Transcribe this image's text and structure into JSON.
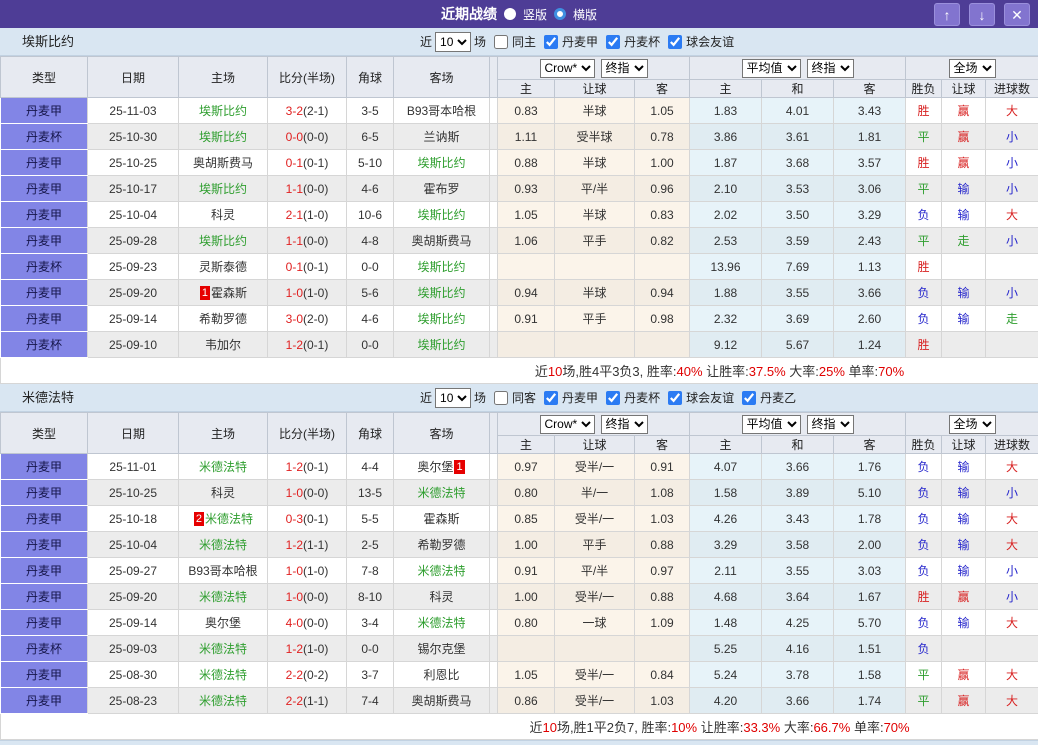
{
  "titlebar": {
    "title": "近期战绩",
    "options": [
      {
        "label": "竖版",
        "selected": true
      },
      {
        "label": "横版",
        "selected": false
      }
    ],
    "buttons": {
      "up": "↑",
      "down": "↓",
      "close": "✕"
    }
  },
  "table_header": {
    "left_cols": [
      "类型",
      "日期",
      "主场",
      "比分(半场)",
      "角球",
      "客场"
    ],
    "let_cols": [
      "主",
      "让球",
      "客"
    ],
    "avg_cols": [
      "主",
      "和",
      "客"
    ],
    "result_cols": [
      "胜负",
      "让球",
      "进球数"
    ],
    "dropdowns": {
      "bookmaker": "Crow*",
      "bookmaker_time": "终指",
      "average": "平均值",
      "average_time": "终指",
      "scope": "全场"
    }
  },
  "colors": {
    "accent_purple": "#4e3d96",
    "type_cell": "#8285e6",
    "self_team_green": "#2e9e2e",
    "win_red": "#d82222",
    "lose_blue": "#2626cc",
    "draw_green": "#2e9e2e",
    "result_map": {
      "胜": "red",
      "平": "green",
      "负": "blue",
      "赢": "red",
      "输": "blue",
      "走": "green",
      "大": "red",
      "小": "blue"
    }
  },
  "sections": [
    {
      "team": "埃斯比约",
      "filter": {
        "near_label": "近",
        "count": "10",
        "games_label": "场",
        "same": {
          "label": "同主",
          "checked": false
        },
        "leagues": [
          {
            "label": "丹麦甲",
            "checked": true
          },
          {
            "label": "丹麦杯",
            "checked": true
          },
          {
            "label": "球会友谊",
            "checked": true
          }
        ]
      },
      "rows": [
        {
          "type": "丹麦甲",
          "date": "25-11-03",
          "home": "埃斯比约",
          "home_self": true,
          "score": "3-2",
          "half": "(2-1)",
          "corner": "3-5",
          "away": "B93哥本哈根",
          "let": [
            "0.83",
            "半球",
            "1.05"
          ],
          "avg": [
            "1.83",
            "4.01",
            "3.43"
          ],
          "res": [
            "胜",
            "赢",
            "大"
          ]
        },
        {
          "type": "丹麦杯",
          "date": "25-10-30",
          "home": "埃斯比约",
          "home_self": true,
          "score": "0-0",
          "half": "(0-0)",
          "corner": "6-5",
          "away": "兰讷斯",
          "let": [
            "1.11",
            "受半球",
            "0.78"
          ],
          "avg": [
            "3.86",
            "3.61",
            "1.81"
          ],
          "res": [
            "平",
            "赢",
            "小"
          ]
        },
        {
          "type": "丹麦甲",
          "date": "25-10-25",
          "home": "奥胡斯费马",
          "score": "0-1",
          "half": "(0-1)",
          "corner": "5-10",
          "away": "埃斯比约",
          "away_self": true,
          "let": [
            "0.88",
            "半球",
            "1.00"
          ],
          "avg": [
            "1.87",
            "3.68",
            "3.57"
          ],
          "res": [
            "胜",
            "赢",
            "小"
          ]
        },
        {
          "type": "丹麦甲",
          "date": "25-10-17",
          "home": "埃斯比约",
          "home_self": true,
          "score": "1-1",
          "half": "(0-0)",
          "corner": "4-6",
          "away": "霍布罗",
          "let": [
            "0.93",
            "平/半",
            "0.96"
          ],
          "avg": [
            "2.10",
            "3.53",
            "3.06"
          ],
          "res": [
            "平",
            "输",
            "小"
          ]
        },
        {
          "type": "丹麦甲",
          "date": "25-10-04",
          "home": "科灵",
          "score": "2-1",
          "half": "(1-0)",
          "corner": "10-6",
          "away": "埃斯比约",
          "away_self": true,
          "let": [
            "1.05",
            "半球",
            "0.83"
          ],
          "avg": [
            "2.02",
            "3.50",
            "3.29"
          ],
          "res": [
            "负",
            "输",
            "大"
          ]
        },
        {
          "type": "丹麦甲",
          "date": "25-09-28",
          "home": "埃斯比约",
          "home_self": true,
          "score": "1-1",
          "half": "(0-0)",
          "corner": "4-8",
          "away": "奥胡斯费马",
          "let": [
            "1.06",
            "平手",
            "0.82"
          ],
          "avg": [
            "2.53",
            "3.59",
            "2.43"
          ],
          "res": [
            "平",
            "走",
            "小"
          ]
        },
        {
          "type": "丹麦杯",
          "date": "25-09-23",
          "home": "灵斯泰德",
          "score": "0-1",
          "half": "(0-1)",
          "corner": "0-0",
          "away": "埃斯比约",
          "away_self": true,
          "let": [
            "",
            "",
            ""
          ],
          "avg": [
            "13.96",
            "7.69",
            "1.13"
          ],
          "res": [
            "胜",
            "",
            ""
          ]
        },
        {
          "type": "丹麦甲",
          "date": "25-09-20",
          "home": "霍森斯",
          "home_badge": "1",
          "score": "1-0",
          "half": "(1-0)",
          "corner": "5-6",
          "away": "埃斯比约",
          "away_self": true,
          "let": [
            "0.94",
            "半球",
            "0.94"
          ],
          "avg": [
            "1.88",
            "3.55",
            "3.66"
          ],
          "res": [
            "负",
            "输",
            "小"
          ]
        },
        {
          "type": "丹麦甲",
          "date": "25-09-14",
          "home": "希勒罗德",
          "score": "3-0",
          "half": "(2-0)",
          "corner": "4-6",
          "away": "埃斯比约",
          "away_self": true,
          "let": [
            "0.91",
            "平手",
            "0.98"
          ],
          "avg": [
            "2.32",
            "3.69",
            "2.60"
          ],
          "res": [
            "负",
            "输",
            "走"
          ]
        },
        {
          "type": "丹麦杯",
          "date": "25-09-10",
          "home": "韦加尔",
          "score": "1-2",
          "half": "(0-1)",
          "corner": "0-0",
          "away": "埃斯比约",
          "away_self": true,
          "let": [
            "",
            "",
            ""
          ],
          "avg": [
            "9.12",
            "5.67",
            "1.24"
          ],
          "res": [
            "胜",
            "",
            ""
          ]
        }
      ],
      "summary": [
        {
          "text": "近",
          "red": false
        },
        {
          "text": "10",
          "red": true
        },
        {
          "text": "场,胜4平3负3, 胜率:",
          "red": false
        },
        {
          "text": "40%",
          "red": true
        },
        {
          "text": " 让胜率:",
          "red": false
        },
        {
          "text": "37.5%",
          "red": true
        },
        {
          "text": " 大率:",
          "red": false
        },
        {
          "text": "25%",
          "red": true
        },
        {
          "text": " 单率:",
          "red": false
        },
        {
          "text": "70%",
          "red": true
        }
      ]
    },
    {
      "team": "米德法特",
      "filter": {
        "near_label": "近",
        "count": "10",
        "games_label": "场",
        "same": {
          "label": "同客",
          "checked": false
        },
        "leagues": [
          {
            "label": "丹麦甲",
            "checked": true
          },
          {
            "label": "丹麦杯",
            "checked": true
          },
          {
            "label": "球会友谊",
            "checked": true
          },
          {
            "label": "丹麦乙",
            "checked": true
          }
        ]
      },
      "rows": [
        {
          "type": "丹麦甲",
          "date": "25-11-01",
          "home": "米德法特",
          "home_self": true,
          "score": "1-2",
          "half": "(0-1)",
          "corner": "4-4",
          "away": "奥尔堡",
          "away_badge_post": "1",
          "let": [
            "0.97",
            "受半/一",
            "0.91"
          ],
          "avg": [
            "4.07",
            "3.66",
            "1.76"
          ],
          "res": [
            "负",
            "输",
            "大"
          ]
        },
        {
          "type": "丹麦甲",
          "date": "25-10-25",
          "home": "科灵",
          "score": "1-0",
          "half": "(0-0)",
          "corner": "13-5",
          "away": "米德法特",
          "away_self": true,
          "let": [
            "0.80",
            "半/一",
            "1.08"
          ],
          "avg": [
            "1.58",
            "3.89",
            "5.10"
          ],
          "res": [
            "负",
            "输",
            "小"
          ]
        },
        {
          "type": "丹麦甲",
          "date": "25-10-18",
          "home": "米德法特",
          "home_self": true,
          "home_badge": "2",
          "score": "0-3",
          "half": "(0-1)",
          "corner": "5-5",
          "away": "霍森斯",
          "let": [
            "0.85",
            "受半/一",
            "1.03"
          ],
          "avg": [
            "4.26",
            "3.43",
            "1.78"
          ],
          "res": [
            "负",
            "输",
            "大"
          ]
        },
        {
          "type": "丹麦甲",
          "date": "25-10-04",
          "home": "米德法特",
          "home_self": true,
          "score": "1-2",
          "half": "(1-1)",
          "corner": "2-5",
          "away": "希勒罗德",
          "let": [
            "1.00",
            "平手",
            "0.88"
          ],
          "avg": [
            "3.29",
            "3.58",
            "2.00"
          ],
          "res": [
            "负",
            "输",
            "大"
          ]
        },
        {
          "type": "丹麦甲",
          "date": "25-09-27",
          "home": "B93哥本哈根",
          "score": "1-0",
          "half": "(1-0)",
          "corner": "7-8",
          "away": "米德法特",
          "away_self": true,
          "let": [
            "0.91",
            "平/半",
            "0.97"
          ],
          "avg": [
            "2.11",
            "3.55",
            "3.03"
          ],
          "res": [
            "负",
            "输",
            "小"
          ]
        },
        {
          "type": "丹麦甲",
          "date": "25-09-20",
          "home": "米德法特",
          "home_self": true,
          "score": "1-0",
          "half": "(0-0)",
          "corner": "8-10",
          "away": "科灵",
          "let": [
            "1.00",
            "受半/一",
            "0.88"
          ],
          "avg": [
            "4.68",
            "3.64",
            "1.67"
          ],
          "res": [
            "胜",
            "赢",
            "小"
          ]
        },
        {
          "type": "丹麦甲",
          "date": "25-09-14",
          "home": "奥尔堡",
          "score": "4-0",
          "half": "(0-0)",
          "corner": "3-4",
          "away": "米德法特",
          "away_self": true,
          "let": [
            "0.80",
            "一球",
            "1.09"
          ],
          "avg": [
            "1.48",
            "4.25",
            "5.70"
          ],
          "res": [
            "负",
            "输",
            "大"
          ]
        },
        {
          "type": "丹麦杯",
          "date": "25-09-03",
          "home": "米德法特",
          "home_self": true,
          "score": "1-2",
          "half": "(1-0)",
          "corner": "0-0",
          "away": "锡尔克堡",
          "let": [
            "",
            "",
            ""
          ],
          "avg": [
            "5.25",
            "4.16",
            "1.51"
          ],
          "res": [
            "负",
            "",
            ""
          ]
        },
        {
          "type": "丹麦甲",
          "date": "25-08-30",
          "home": "米德法特",
          "home_self": true,
          "score": "2-2",
          "half": "(0-2)",
          "corner": "3-7",
          "away": "利恩比",
          "let": [
            "1.05",
            "受半/一",
            "0.84"
          ],
          "avg": [
            "5.24",
            "3.78",
            "1.58"
          ],
          "res": [
            "平",
            "赢",
            "大"
          ]
        },
        {
          "type": "丹麦甲",
          "date": "25-08-23",
          "home": "米德法特",
          "home_self": true,
          "score": "2-2",
          "half": "(1-1)",
          "corner": "7-4",
          "away": "奥胡斯费马",
          "let": [
            "0.86",
            "受半/一",
            "1.03"
          ],
          "avg": [
            "4.20",
            "3.66",
            "1.74"
          ],
          "res": [
            "平",
            "赢",
            "大"
          ]
        }
      ],
      "summary": [
        {
          "text": "近",
          "red": false
        },
        {
          "text": "10",
          "red": true
        },
        {
          "text": "场,胜1平2负7, 胜率:",
          "red": false
        },
        {
          "text": "10%",
          "red": true
        },
        {
          "text": " 让胜率:",
          "red": false
        },
        {
          "text": "33.3%",
          "red": true
        },
        {
          "text": " 大率:",
          "red": false
        },
        {
          "text": "66.7%",
          "red": true
        },
        {
          "text": " 单率:",
          "red": false
        },
        {
          "text": "70%",
          "red": true
        }
      ]
    }
  ]
}
